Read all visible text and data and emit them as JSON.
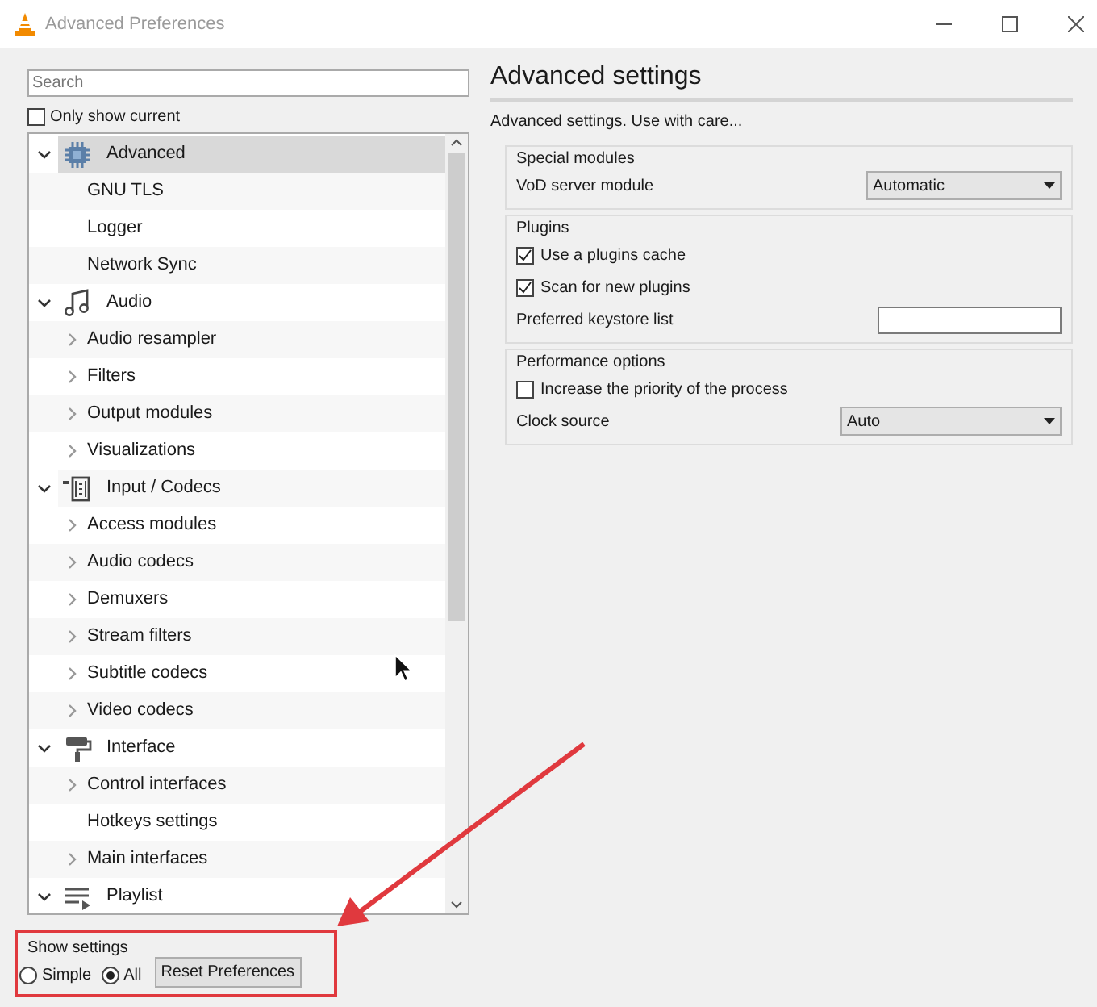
{
  "window": {
    "title": "Advanced Preferences"
  },
  "search": {
    "placeholder": "Search"
  },
  "only_show_current": {
    "label": "Only show current",
    "checked": false
  },
  "tree": [
    {
      "label": "Advanced",
      "expanded": true,
      "selected": true,
      "children": [
        {
          "label": "GNU TLS",
          "expandable": false
        },
        {
          "label": "Logger",
          "expandable": false
        },
        {
          "label": "Network Sync",
          "expandable": false
        }
      ]
    },
    {
      "label": "Audio",
      "expanded": true,
      "selected": false,
      "children": [
        {
          "label": "Audio resampler",
          "expandable": true
        },
        {
          "label": "Filters",
          "expandable": true
        },
        {
          "label": "Output modules",
          "expandable": true
        },
        {
          "label": "Visualizations",
          "expandable": true
        }
      ]
    },
    {
      "label": "Input / Codecs",
      "expanded": true,
      "selected": false,
      "children": [
        {
          "label": "Access modules",
          "expandable": true
        },
        {
          "label": "Audio codecs",
          "expandable": true
        },
        {
          "label": "Demuxers",
          "expandable": true
        },
        {
          "label": "Stream filters",
          "expandable": true
        },
        {
          "label": "Subtitle codecs",
          "expandable": true
        },
        {
          "label": "Video codecs",
          "expandable": true
        }
      ]
    },
    {
      "label": "Interface",
      "expanded": true,
      "selected": false,
      "children": [
        {
          "label": "Control interfaces",
          "expandable": true
        },
        {
          "label": "Hotkeys settings",
          "expandable": false
        },
        {
          "label": "Main interfaces",
          "expandable": true
        }
      ]
    },
    {
      "label": "Playlist",
      "expanded": true,
      "selected": false
    }
  ],
  "show_settings": {
    "title": "Show settings",
    "options": [
      {
        "label": "Simple",
        "selected": false
      },
      {
        "label": "All",
        "selected": true
      }
    ]
  },
  "reset_button": "Reset Preferences",
  "panel": {
    "title": "Advanced settings",
    "description": "Advanced settings. Use with care...",
    "groups": [
      {
        "title": "Special modules",
        "rows": [
          {
            "kind": "dropdown",
            "label": "VoD server module",
            "value": "Automatic"
          }
        ]
      },
      {
        "title": "Plugins",
        "rows": [
          {
            "kind": "checkbox",
            "label": "Use a plugins cache",
            "checked": true
          },
          {
            "kind": "checkbox",
            "label": "Scan for new plugins",
            "checked": true
          },
          {
            "kind": "text",
            "label": "Preferred keystore list"
          }
        ]
      },
      {
        "title": "Performance options",
        "rows": [
          {
            "kind": "checkbox",
            "label": "Increase the priority of the process",
            "checked": false
          },
          {
            "kind": "dropdown",
            "label": "Clock source",
            "value": "Auto"
          }
        ]
      }
    ]
  }
}
